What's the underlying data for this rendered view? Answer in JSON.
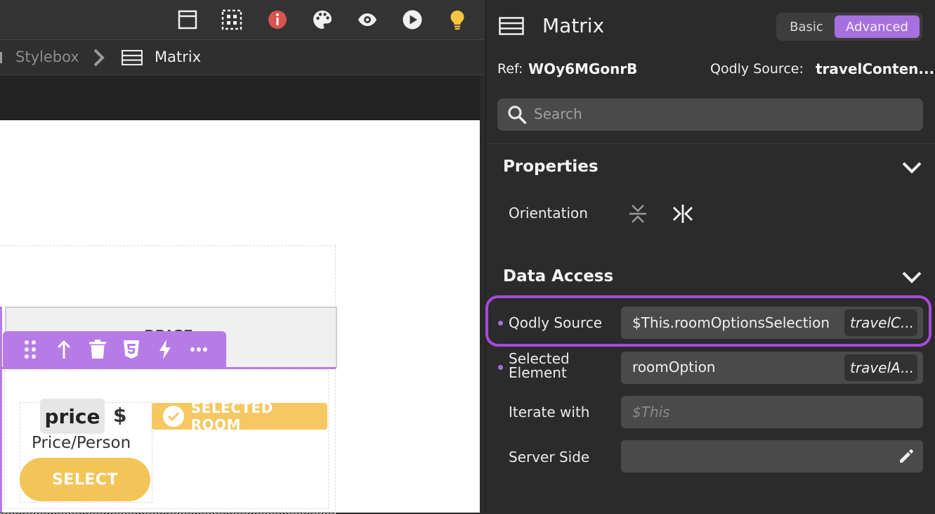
{
  "breadcrumb": {
    "items": [
      "Stylebox",
      "Matrix"
    ]
  },
  "canvas": {
    "table_header": "PRICE",
    "price_chip": "price",
    "currency": "$",
    "price_caption": "Price/Person",
    "select_button": "SELECT",
    "selected_badge": "SELECTED ROOM"
  },
  "panel": {
    "title": "Matrix",
    "modes": {
      "basic": "Basic",
      "advanced": "Advanced",
      "active": "Advanced"
    },
    "ref_label": "Ref:",
    "ref_value": "WOy6MGonrB",
    "source_label": "Qodly Source:",
    "source_value": "travelConten...",
    "search_placeholder": "Search",
    "properties": {
      "title": "Properties",
      "orientation_label": "Orientation"
    },
    "data_access": {
      "title": "Data Access",
      "qodly_source_label": "Qodly Source",
      "qodly_source_value": "$This.roomOptionsSelection",
      "qodly_source_tag": "travelC...",
      "selected_element_label_1": "Selected",
      "selected_element_label_2": "Element",
      "selected_element_value": "roomOption",
      "selected_element_tag": "travelA...",
      "iterate_label": "Iterate with",
      "iterate_placeholder": "$This",
      "server_side_label": "Server Side"
    }
  },
  "colors": {
    "accent": "#a670e0",
    "highlight": "#a64ad9",
    "selection": "#b77be6",
    "select_button": "#f3c558",
    "info_icon": "#d9534f",
    "bulb_icon": "#f5c542"
  },
  "icons": [
    "layout-icon",
    "grid-select-icon",
    "info-icon",
    "palette-icon",
    "eye-icon",
    "play-icon",
    "bulb-icon",
    "chevron-right-icon",
    "matrix-icon",
    "search-icon",
    "chevron-down-icon",
    "orientation-vertical-icon",
    "orientation-horizontal-icon",
    "pencil-icon",
    "drag-handle-icon",
    "arrow-up-icon",
    "trash-icon",
    "css-icon",
    "lightning-icon",
    "more-icon",
    "check-icon"
  ]
}
